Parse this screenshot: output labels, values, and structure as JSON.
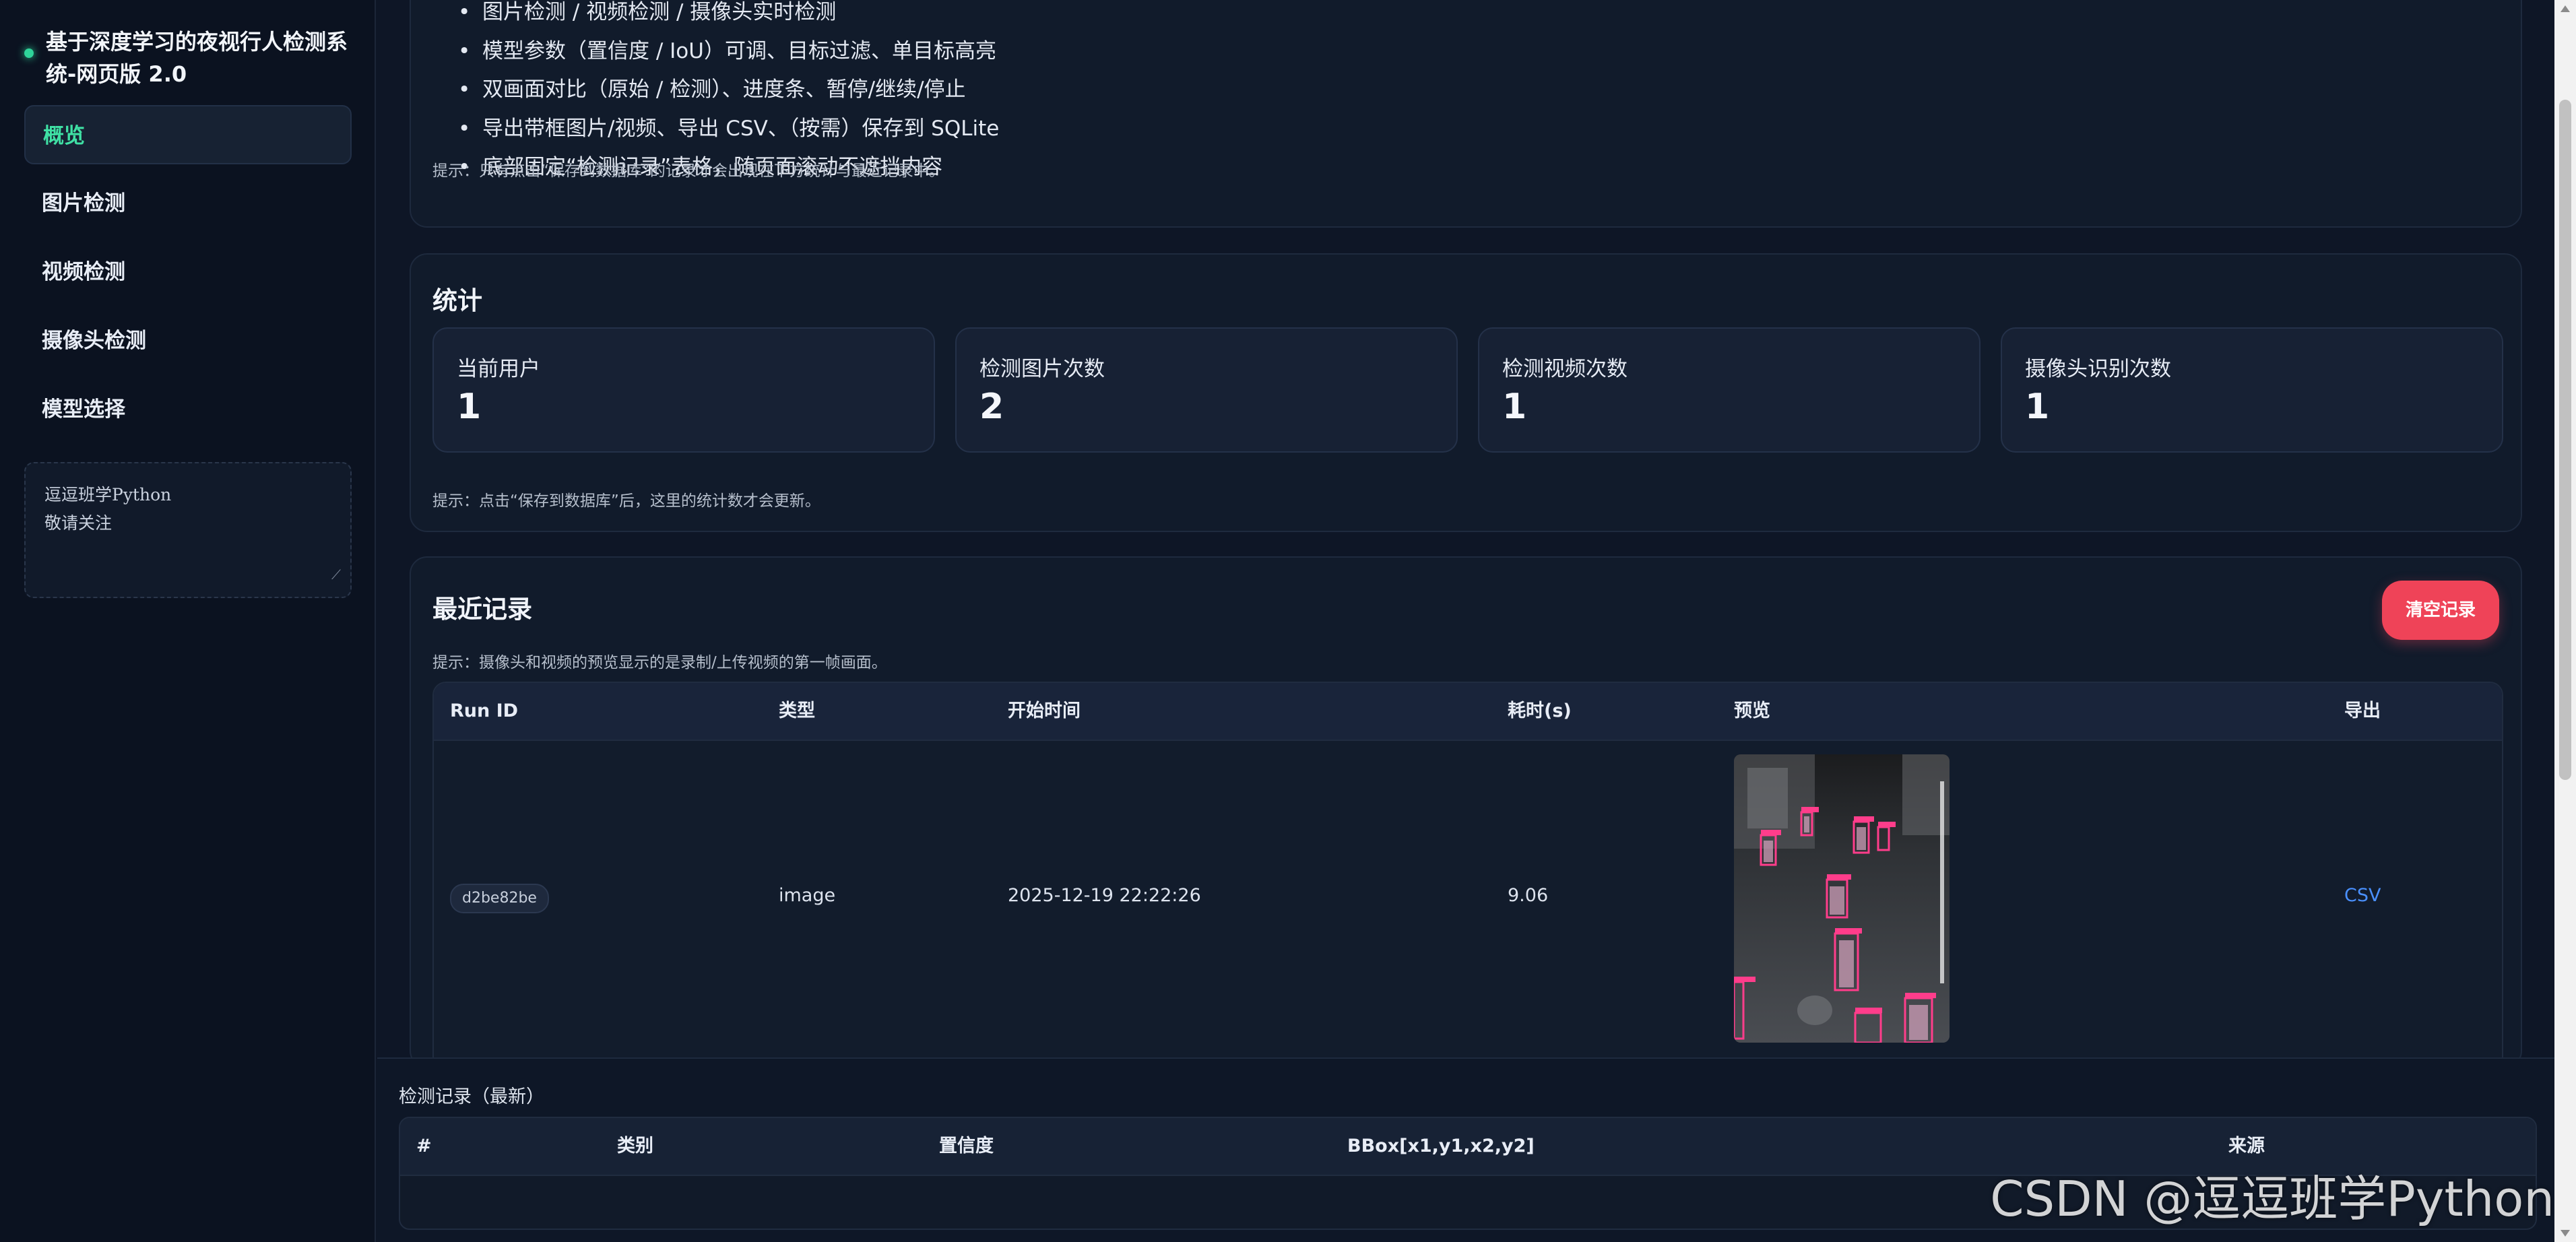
{
  "sidebar": {
    "brand": "基于深度学习的夜视行人检测系统-网页版 2.0",
    "nav": [
      {
        "label": "概览",
        "active": true
      },
      {
        "label": "图片检测"
      },
      {
        "label": "视频检测"
      },
      {
        "label": "摄像头检测"
      },
      {
        "label": "模型选择"
      }
    ],
    "note_lines": [
      "逗逗班学Python",
      "敬请关注"
    ]
  },
  "features": {
    "items": [
      "图片检测 / 视频检测 / 摄像头实时检测",
      "模型参数（置信度 / IoU）可调、目标过滤、单目标高亮",
      "双画面对比（原始 / 检测）、进度条、暂停/继续/停止",
      "导出带框图片/视频、导出 CSV、（按需）保存到 SQLite",
      "底部固定“检测记录”表格，随页面滚动不遮挡内容"
    ],
    "hint": "提示：只有点击“保存到数据库”的记录才会出现在下方统计与最近记录中。"
  },
  "stats": {
    "title": "统计",
    "items": [
      {
        "label": "当前用户",
        "value": "1"
      },
      {
        "label": "检测图片次数",
        "value": "2"
      },
      {
        "label": "检测视频次数",
        "value": "1"
      },
      {
        "label": "摄像头识别次数",
        "value": "1"
      }
    ],
    "hint": "提示：点击“保存到数据库”后，这里的统计数才会更新。"
  },
  "recent": {
    "title": "最近记录",
    "clear_label": "清空记录",
    "hint": "提示：摄像头和视频的预览显示的是录制/上传视频的第一帧画面。",
    "columns": [
      "Run ID",
      "类型",
      "开始时间",
      "耗时(s)",
      "预览",
      "导出"
    ],
    "rows": [
      {
        "run_id": "d2be82be",
        "type": "image",
        "start": "2025-12-19 22:22:26",
        "duration": "9.06",
        "export": "CSV"
      }
    ]
  },
  "detections": {
    "title": "检测记录（最新）",
    "columns": [
      "#",
      "类别",
      "置信度",
      "BBox[x1,y1,x2,y2]",
      "来源"
    ]
  },
  "watermark": "CSDN @逗逗班学Python",
  "colors": {
    "accent": "#3fe0a4",
    "danger": "#ef4358",
    "link": "#4a90ff",
    "box": "#ff3d8b",
    "background": "#0e1626"
  }
}
